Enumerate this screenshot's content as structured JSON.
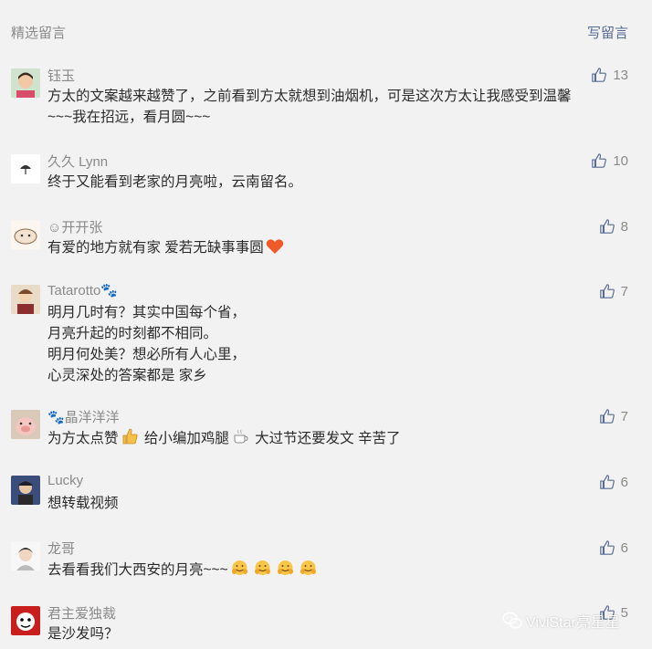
{
  "header": {
    "section_title": "精选留言",
    "write_comment": "写留言"
  },
  "comments": [
    {
      "name": "钰玉",
      "likes": "13",
      "lines": [
        "方太的文案越来越赞了，之前看到方太就想到油烟机，可是这次方太让我感受到温馨",
        "~~~我在招远，看月圆~~~"
      ]
    },
    {
      "name": "久久 Lynn",
      "likes": "10",
      "lines": [
        "终于又能看到老家的月亮啦，云南留名。"
      ]
    },
    {
      "name": "☺开开张",
      "likes": "8",
      "lines": [
        "有爱的地方就有家    爱若无缺事事圆"
      ]
    },
    {
      "name": "Tatarotto🐾",
      "likes": "7",
      "lines": [
        "明月几时有？其实中国每个省，",
        "月亮升起的时刻都不相同。",
        "明月何处美？想必所有人心里，",
        "心灵深处的答案都是 家乡"
      ]
    },
    {
      "name": "🐾晶洋洋洋",
      "likes": "7",
      "line_a": "为方太点赞",
      "line_b": " 给小编加鸡腿",
      "line_c": " 大过节还要发文 辛苦了"
    },
    {
      "name": "Lucky",
      "likes": "6",
      "lines": [
        "想转载视频"
      ]
    },
    {
      "name": "龙哥",
      "likes": "6",
      "lines": [
        "去看看我们大西安的月亮~~~"
      ]
    },
    {
      "name": "君主爱独裁",
      "likes": "5",
      "lines": [
        "是沙发吗？"
      ]
    }
  ],
  "watermark": {
    "text": "ViviStar亮星星"
  },
  "colors": {
    "background": "#f2f2f2",
    "link": "#576b95",
    "meta": "#8a8a8a",
    "text": "#2b2b2b",
    "heart": "#f05a28"
  },
  "icons": {
    "like": "thumbs-up-icon",
    "heart": "heart-icon",
    "clap": "thumbs-up-emoji-icon",
    "coffee": "coffee-cup-icon",
    "hug": "hugging-face-icon",
    "wechat": "wechat-icon"
  }
}
